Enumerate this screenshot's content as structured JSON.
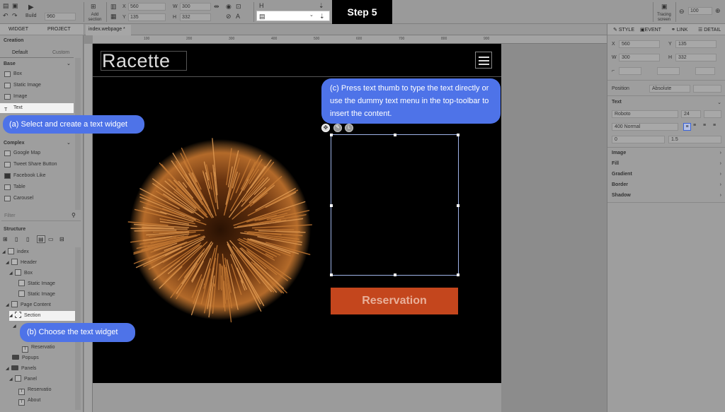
{
  "step_label": "Step 5",
  "toolbar": {
    "build_label": "Build",
    "width_value": "960",
    "add_section_label": "Add section",
    "x_label": "X",
    "x_value": "560",
    "y_label": "Y",
    "y_value": "135",
    "w_label": "W",
    "w_value": "300",
    "h_label": "H",
    "h_value": "332",
    "tracing_label": "Tracing screen",
    "zoom_value": "100"
  },
  "left_panel": {
    "tab_widget": "WIDGET",
    "tab_project": "PROJECT",
    "creation_label": "Creation",
    "sub_default": "Default",
    "sub_custom": "Custom",
    "base_label": "Base",
    "base_items": [
      "Box",
      "Static Image",
      "Image",
      "Text"
    ],
    "complex_label": "Complex",
    "complex_items": [
      "Google Map",
      "Tweet Share Button",
      "Facebook Like",
      "Table",
      "Carousel"
    ],
    "filter_placeholder": "Filter",
    "structure_label": "Structure",
    "tree": [
      "index",
      "Header",
      "Box",
      "Static Image",
      "Static Image",
      "Page Content",
      "Section",
      "Reservatio",
      "Popups",
      "Panels",
      "Panel",
      "Reservatio",
      "About"
    ]
  },
  "document_tab": "index.webpage *",
  "ruler_ticks": [
    "100",
    "200",
    "300",
    "400",
    "500",
    "600",
    "700",
    "800",
    "900"
  ],
  "page": {
    "logo_text": "Racette",
    "reservation_label": "Reservation"
  },
  "right_panel": {
    "tab_style": "STYLE",
    "tab_event": "EVENT",
    "tab_link": "LINK",
    "tab_detail": "DETAIL",
    "x_value": "560",
    "y_value": "135",
    "w_value": "300",
    "h_value": "332",
    "position_label": "Position",
    "position_value": "Absolute",
    "text_label": "Text",
    "font_value": "Roboto",
    "font_size": "24",
    "font_weight": "400 Normal",
    "letter_spacing": "0",
    "line_height": "1.5",
    "sections": [
      "Image",
      "Fill",
      "Gradient",
      "Border",
      "Shadow"
    ]
  },
  "callouts": {
    "a": "(a) Select and create a text widget",
    "b": "(b) Choose the text widget",
    "c": "(c) Press text thumb to type the text directly or use the dummy text menu in the top-toolbar to insert the content."
  }
}
